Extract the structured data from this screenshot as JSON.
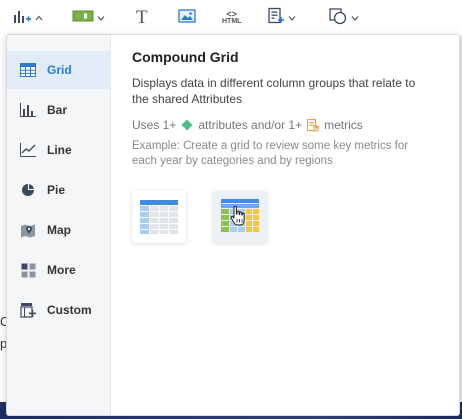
{
  "toolbar": {
    "items": [
      {
        "icon": "chart-add-icon"
      },
      {
        "icon": "color-fill-icon"
      },
      {
        "icon": "text-icon",
        "glyph": "T"
      },
      {
        "icon": "image-icon"
      },
      {
        "icon": "html-icon",
        "glyph": "<>",
        "label": "HTML"
      },
      {
        "icon": "filter-add-icon"
      },
      {
        "icon": "shapes-icon"
      }
    ]
  },
  "background": {
    "letters": [
      "C",
      "p"
    ]
  },
  "sidebar": {
    "items": [
      {
        "label": "Grid",
        "icon": "grid-icon",
        "active": true
      },
      {
        "label": "Bar",
        "icon": "bar-chart-icon"
      },
      {
        "label": "Line",
        "icon": "line-chart-icon"
      },
      {
        "label": "Pie",
        "icon": "pie-chart-icon"
      },
      {
        "label": "Map",
        "icon": "map-icon"
      },
      {
        "label": "More",
        "icon": "more-visualizations-icon"
      },
      {
        "label": "Custom",
        "icon": "custom-visualization-icon"
      }
    ]
  },
  "detail": {
    "title": "Compound Grid",
    "description": "Displays data in different column groups that relate to the shared Attributes",
    "uses_prefix": "Uses 1+",
    "uses_attributes": "attributes and/or 1+",
    "uses_metrics": "metrics",
    "example": "Example: Create a grid to review some key metrics for each year by categories and by regions",
    "thumbnails": [
      {
        "name": "grid-thumbnail"
      },
      {
        "name": "compound-grid-thumbnail",
        "selected": true
      }
    ]
  },
  "colors": {
    "accent": "#2d7ad6",
    "attribute": "#4fbf8a",
    "metric": "#e9a23b",
    "active_bg": "#e2ecf7"
  }
}
